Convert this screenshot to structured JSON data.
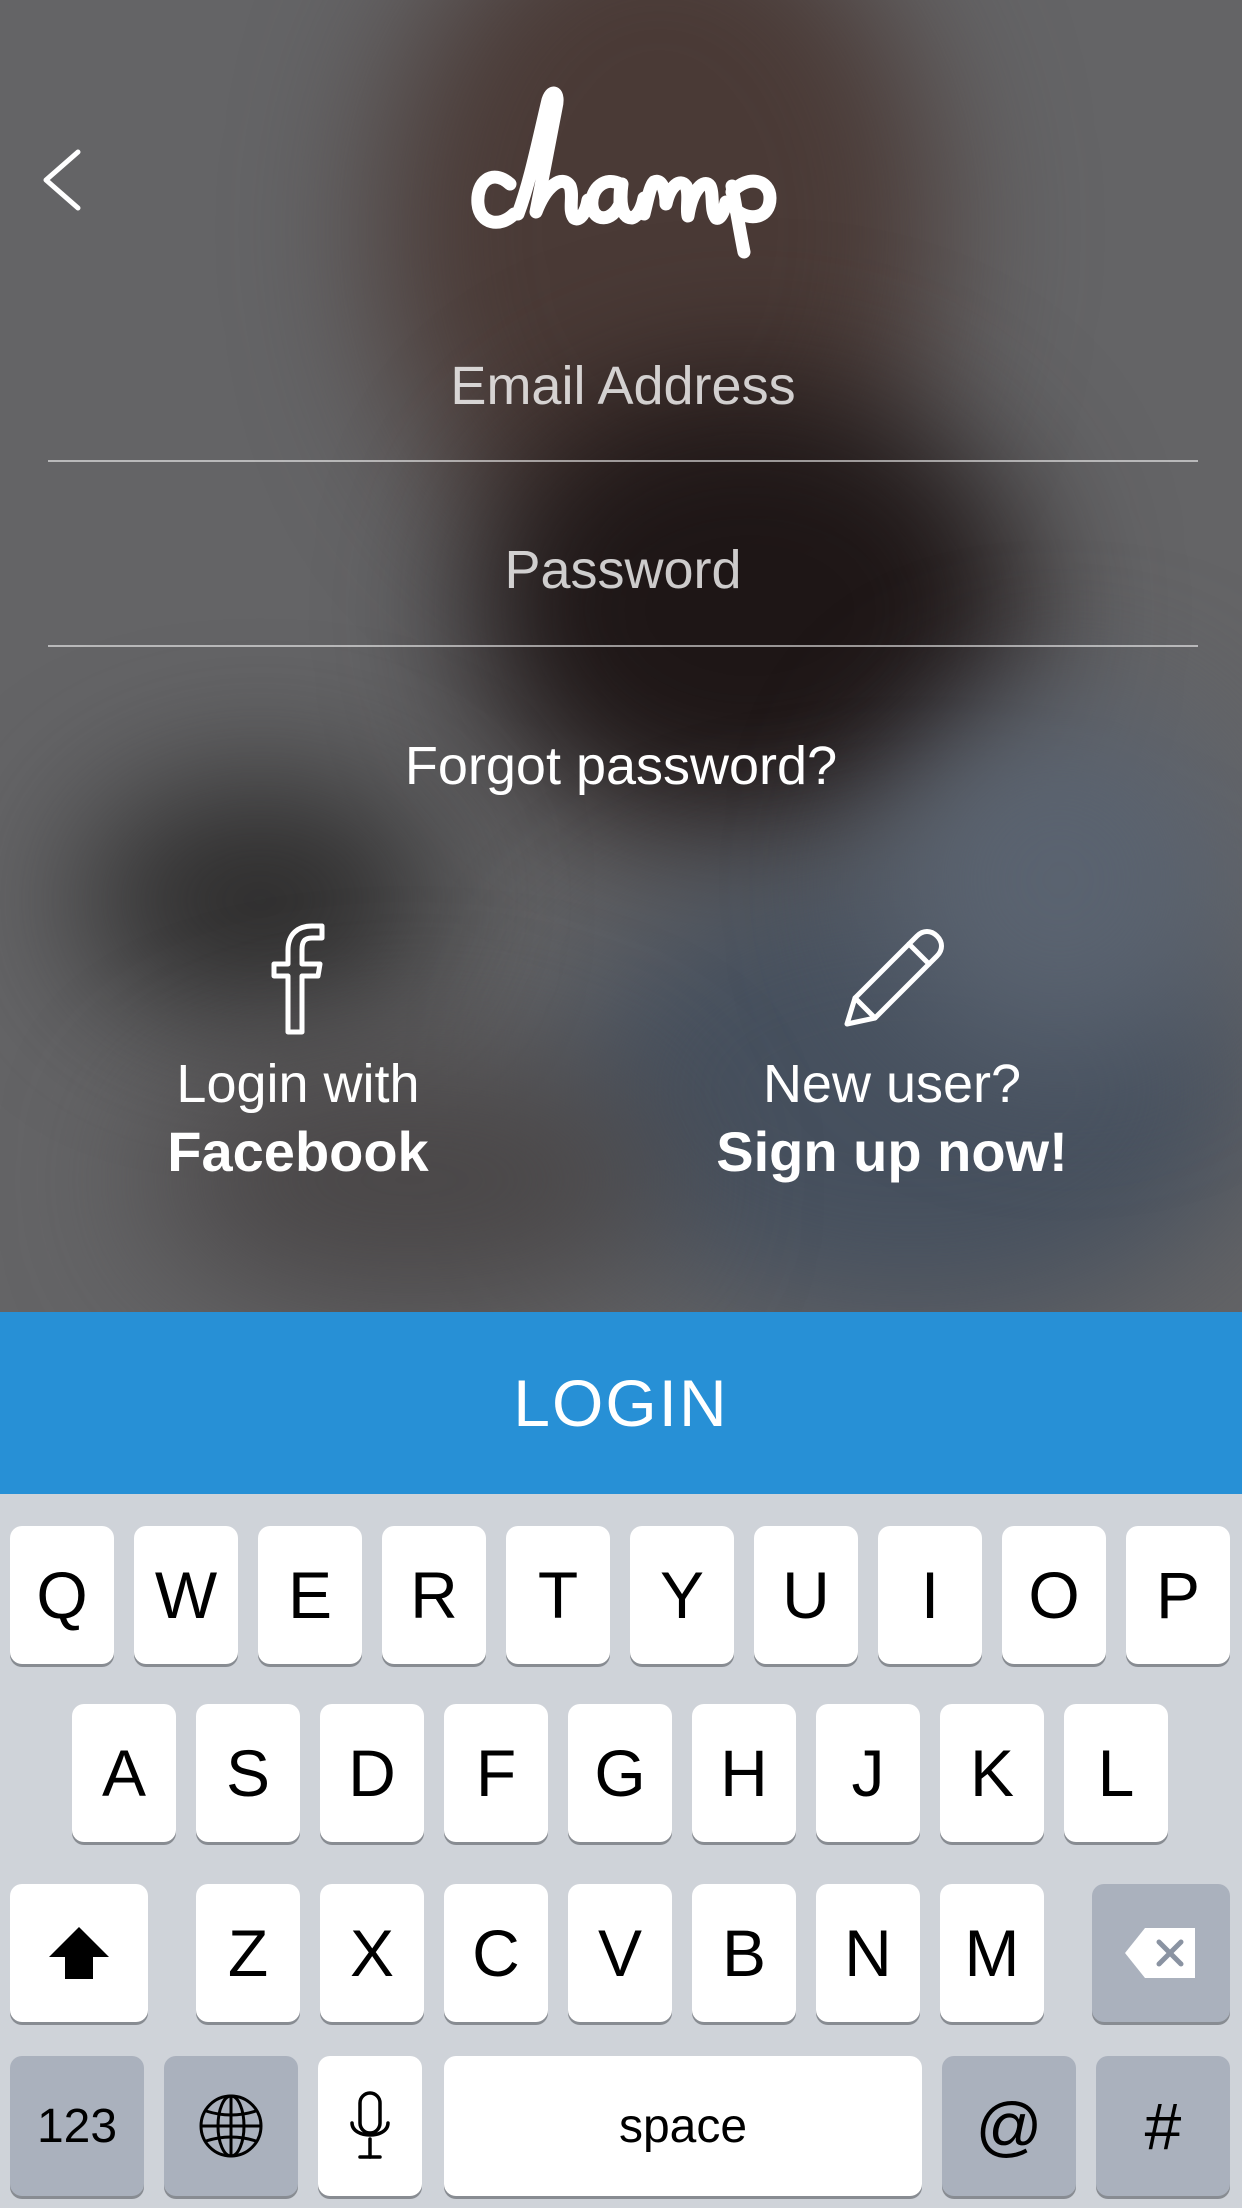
{
  "app": {
    "brand": "champ"
  },
  "form": {
    "email_placeholder": "Email Address",
    "password_placeholder": "Password",
    "forgot_label": "Forgot password?"
  },
  "facebook": {
    "line1": "Login  with",
    "line2": "Facebook",
    "icon": "facebook-f-icon"
  },
  "signup": {
    "line1": "New user?",
    "line2": "Sign up now!",
    "icon": "pencil-icon"
  },
  "login_button": {
    "label": "LOGIN",
    "color": "#2790d6"
  },
  "keyboard": {
    "row1": [
      "Q",
      "W",
      "E",
      "R",
      "T",
      "Y",
      "U",
      "I",
      "O",
      "P"
    ],
    "row2": [
      "A",
      "S",
      "D",
      "F",
      "G",
      "H",
      "J",
      "K",
      "L"
    ],
    "row3": [
      "Z",
      "X",
      "C",
      "V",
      "B",
      "N",
      "M"
    ],
    "numbers_label": "123",
    "space_label": "space",
    "at_label": "@",
    "hash_label": "#"
  }
}
